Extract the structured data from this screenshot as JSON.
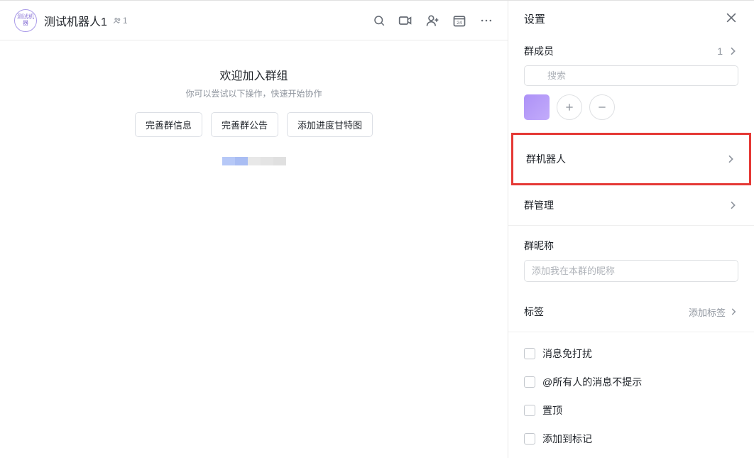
{
  "chat": {
    "avatarText": "测试机器",
    "title": "测试机器人1",
    "memberCount": "1",
    "welcomeTitle": "欢迎加入群组",
    "welcomeSub": "你可以尝试以下操作，快速开始协作",
    "actions": {
      "completeInfo": "完善群信息",
      "completeAnnouncement": "完善群公告",
      "addGantt": "添加进度甘特图"
    },
    "headerCalendarDay": "24"
  },
  "settings": {
    "title": "设置",
    "members": {
      "label": "群成员",
      "count": "1",
      "searchPlaceholder": "搜索"
    },
    "robot": {
      "label": "群机器人"
    },
    "management": {
      "label": "群管理"
    },
    "nickname": {
      "label": "群昵称",
      "placeholder": "添加我在本群的昵称"
    },
    "tags": {
      "label": "标签",
      "addLabel": "添加标签"
    },
    "options": {
      "mute": "消息免打扰",
      "noAtAll": "@所有人的消息不提示",
      "pin": "置顶",
      "addTag": "添加到标记"
    }
  }
}
